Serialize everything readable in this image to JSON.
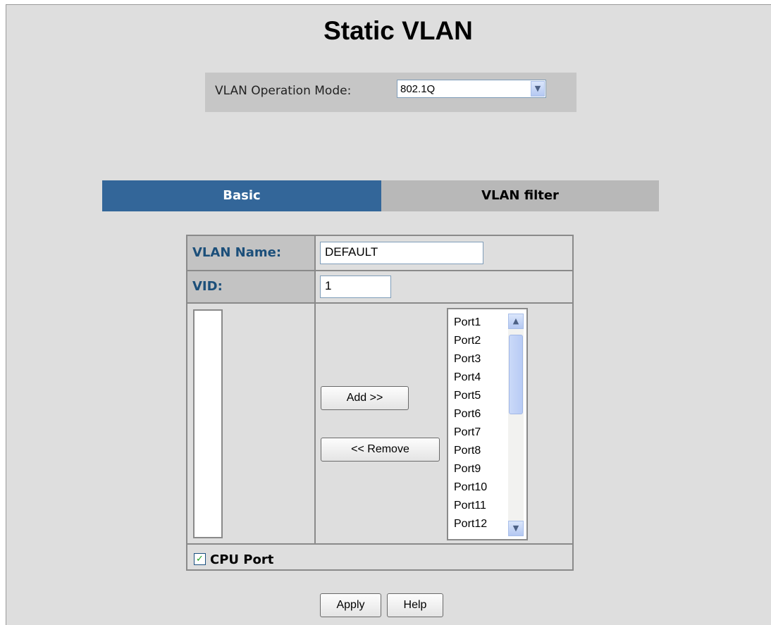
{
  "page": {
    "title": "Static VLAN"
  },
  "mode": {
    "label": "VLAN Operation Mode:",
    "selected": "802.1Q"
  },
  "tabs": {
    "basic": "Basic",
    "filter": "VLAN filter"
  },
  "form": {
    "vlan_name_label": "VLAN Name:",
    "vlan_name_value": "DEFAULT",
    "vid_label": "VID:",
    "vid_value": "1",
    "add_label": "Add   >>",
    "remove_label": "<< Remove",
    "ports": [
      "Port1",
      "Port2",
      "Port3",
      "Port4",
      "Port5",
      "Port6",
      "Port7",
      "Port8",
      "Port9",
      "Port10",
      "Port11",
      "Port12"
    ],
    "cpu_port_label": "CPU Port",
    "cpu_port_checked": true
  },
  "actions": {
    "apply": "Apply",
    "help": "Help"
  },
  "colors": {
    "tab_active": "#336699",
    "tab_inactive": "#b8b8b8",
    "label_text": "#1c4f7a",
    "panel_bg": "#dedede"
  }
}
